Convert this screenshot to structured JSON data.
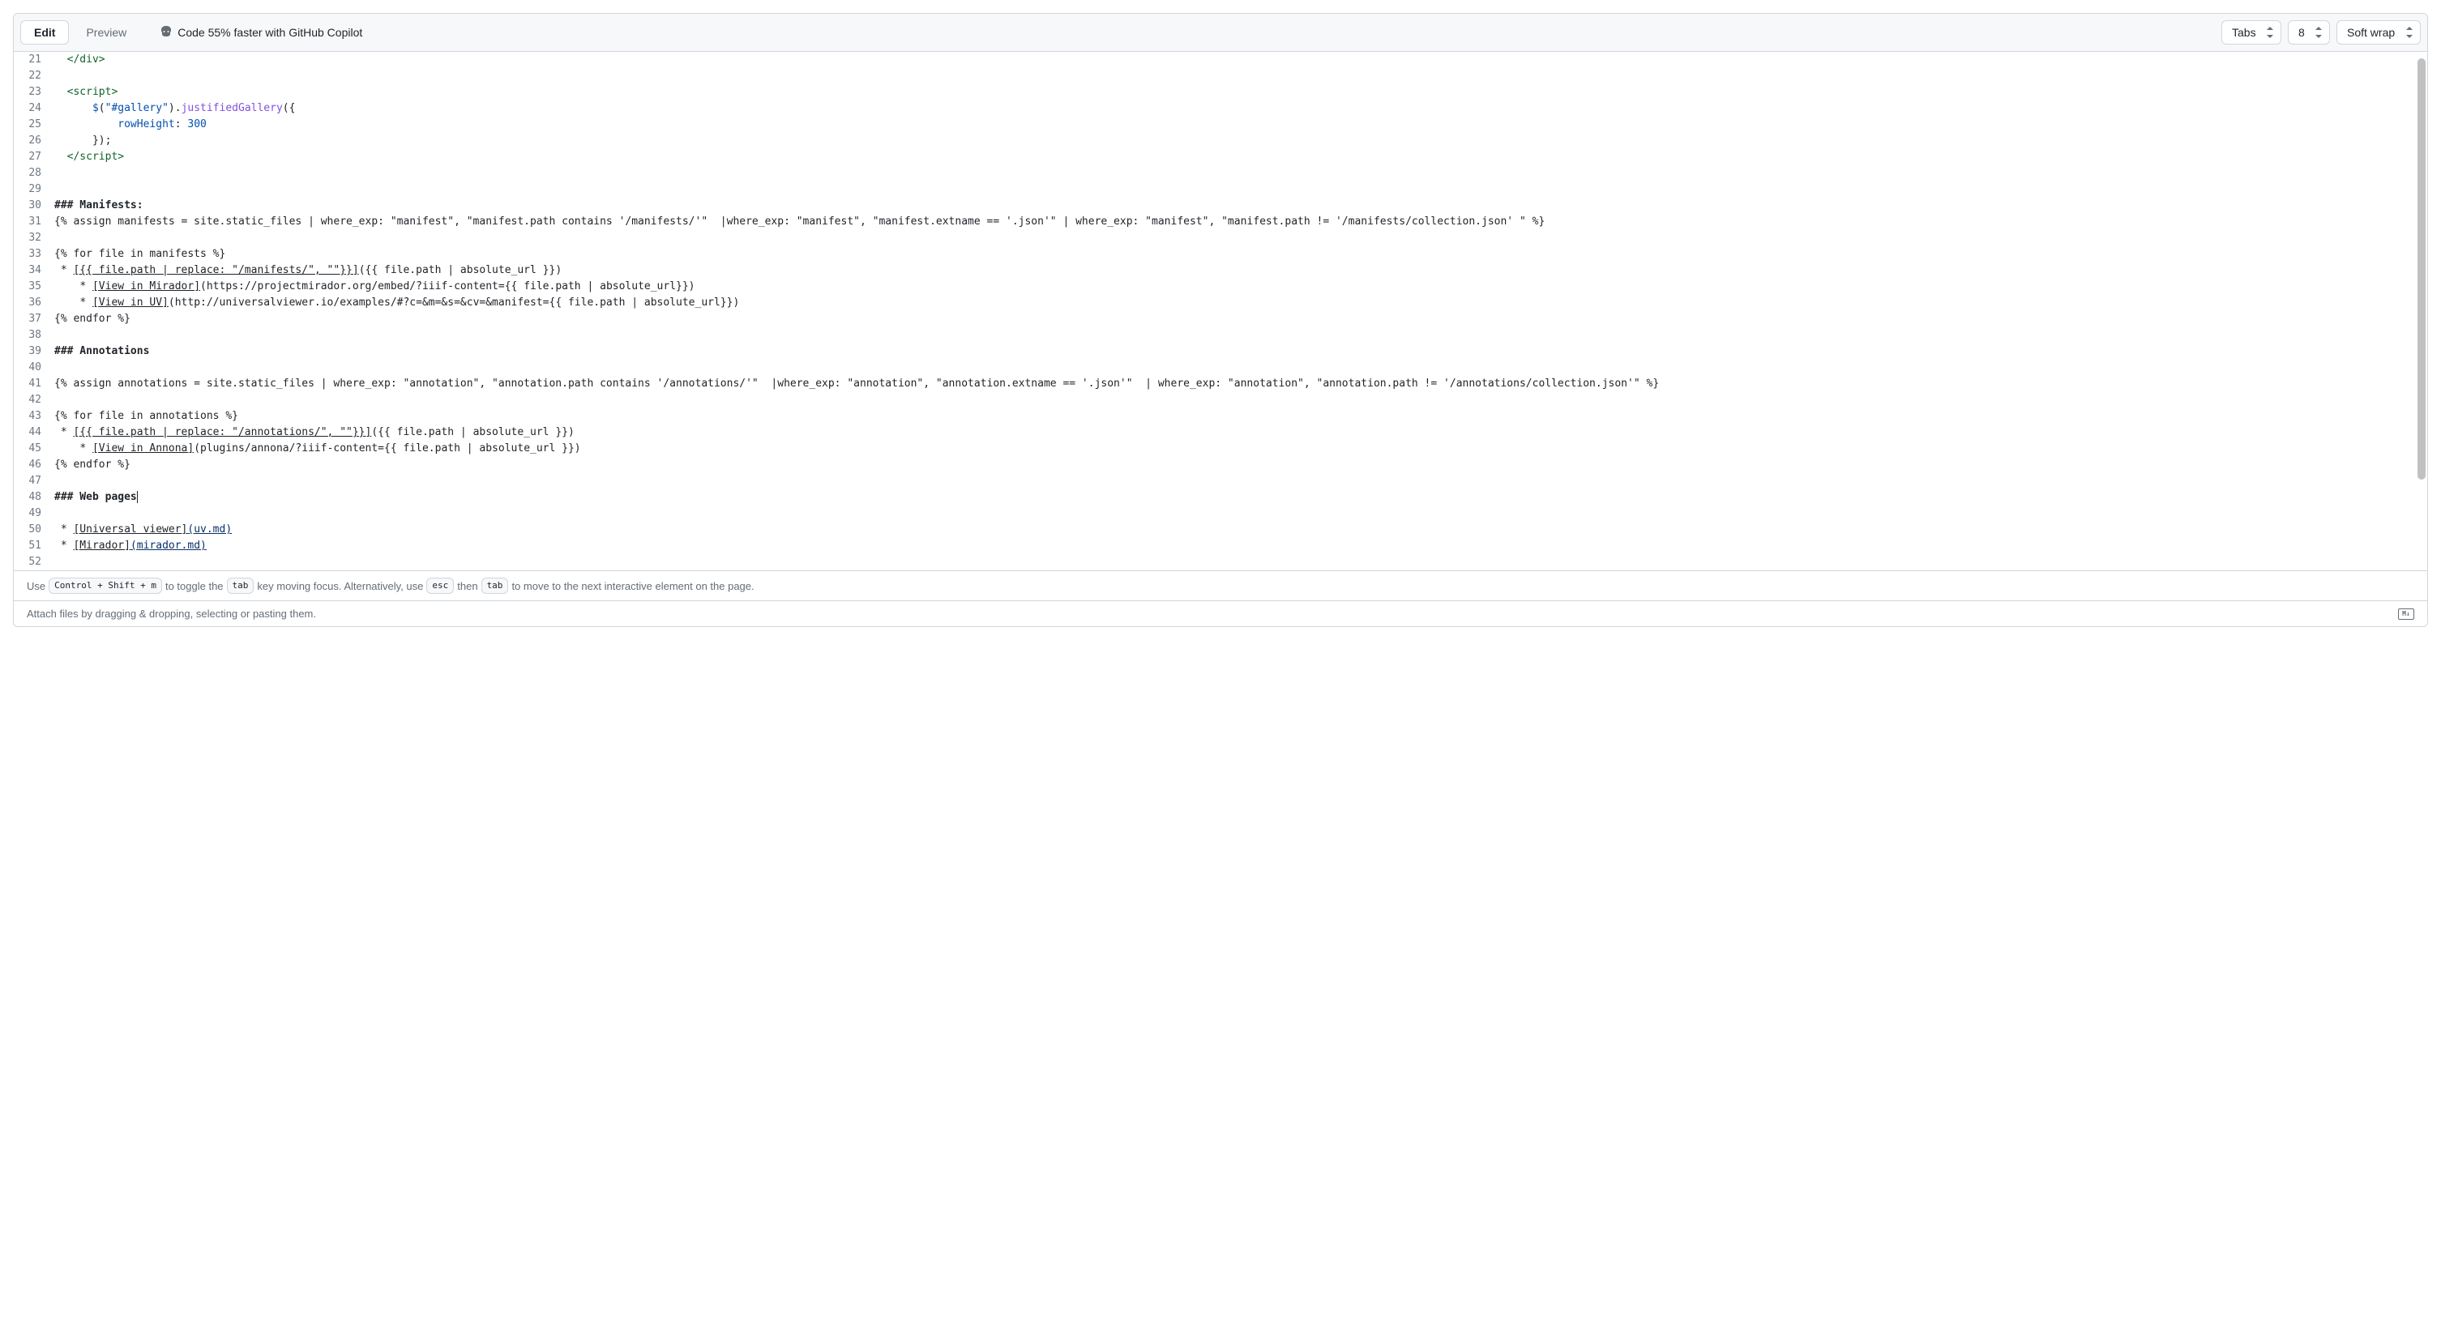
{
  "toolbar": {
    "tabs": {
      "edit": "Edit",
      "preview": "Preview"
    },
    "copilot_hint": "Code 55% faster with GitHub Copilot",
    "selects": {
      "indent": {
        "options": [
          "Tabs"
        ],
        "selected": "Tabs"
      },
      "indent_size": {
        "options": [
          "8"
        ],
        "selected": "8"
      },
      "wrap": {
        "options": [
          "Soft wrap"
        ],
        "selected": "Soft wrap"
      }
    }
  },
  "editor": {
    "first_line_number": 21,
    "lines": [
      {
        "type": "code",
        "segments": [
          {
            "t": "plain",
            "v": "  "
          },
          {
            "t": "tag",
            "v": "</div>"
          }
        ]
      },
      {
        "type": "code",
        "segments": []
      },
      {
        "type": "code",
        "segments": [
          {
            "t": "plain",
            "v": "  "
          },
          {
            "t": "tag",
            "v": "<script>"
          }
        ]
      },
      {
        "type": "code",
        "segments": [
          {
            "t": "plain",
            "v": "      "
          },
          {
            "t": "attr",
            "v": "$"
          },
          {
            "t": "plain",
            "v": "("
          },
          {
            "t": "attr",
            "v": "\"#gallery\""
          },
          {
            "t": "plain",
            "v": ")."
          },
          {
            "t": "func",
            "v": "justifiedGallery"
          },
          {
            "t": "plain",
            "v": "({"
          }
        ]
      },
      {
        "type": "code",
        "segments": [
          {
            "t": "plain",
            "v": "          "
          },
          {
            "t": "attr",
            "v": "rowHeight"
          },
          {
            "t": "plain",
            "v": ": "
          },
          {
            "t": "num",
            "v": "300"
          }
        ]
      },
      {
        "type": "code",
        "segments": [
          {
            "t": "plain",
            "v": "      });"
          }
        ]
      },
      {
        "type": "code",
        "segments": [
          {
            "t": "plain",
            "v": "  "
          },
          {
            "t": "tag",
            "v": "</scr"
          },
          {
            "t": "tag",
            "v": "ipt>"
          }
        ]
      },
      {
        "type": "code",
        "segments": []
      },
      {
        "type": "code",
        "segments": []
      },
      {
        "type": "code",
        "segments": [
          {
            "t": "bold",
            "v": "### Manifests:"
          }
        ]
      },
      {
        "type": "code",
        "segments": [
          {
            "t": "plain",
            "v": "{% assign manifests = site.static_files | where_exp: \"manifest\", \"manifest.path contains '/manifests/'\"  |where_exp: \"manifest\", \"manifest.extname == '.json'\" | where_exp: \"manifest\", \"manifest.path != '/manifests/collection.json' \" %}"
          }
        ]
      },
      {
        "type": "code",
        "segments": []
      },
      {
        "type": "code",
        "segments": [
          {
            "t": "plain",
            "v": "{% for file in manifests %}"
          }
        ]
      },
      {
        "type": "code",
        "segments": [
          {
            "t": "plain",
            "v": " * "
          },
          {
            "t": "link",
            "v": "[{{ file.path | replace: \"/manifests/\", \"\"}}]"
          },
          {
            "t": "plain",
            "v": "({{ file.path | absolute_url }})"
          }
        ]
      },
      {
        "type": "code",
        "segments": [
          {
            "t": "plain",
            "v": "    * "
          },
          {
            "t": "link",
            "v": "[View in Mirador]"
          },
          {
            "t": "plain",
            "v": "(https://projectmirador.org/embed/?iiif-content={{ file.path | absolute_url}})"
          }
        ]
      },
      {
        "type": "code",
        "segments": [
          {
            "t": "plain",
            "v": "    * "
          },
          {
            "t": "link",
            "v": "[View in UV]"
          },
          {
            "t": "plain",
            "v": "(http://universalviewer.io/examples/#?c=&m=&s=&cv=&manifest={{ file.path | absolute_url}})"
          }
        ]
      },
      {
        "type": "code",
        "segments": [
          {
            "t": "plain",
            "v": "{% endfor %}"
          }
        ]
      },
      {
        "type": "code",
        "segments": []
      },
      {
        "type": "code",
        "segments": [
          {
            "t": "bold",
            "v": "### Annotations"
          }
        ]
      },
      {
        "type": "code",
        "segments": []
      },
      {
        "type": "code",
        "segments": [
          {
            "t": "plain",
            "v": "{% assign annotations = site.static_files | where_exp: \"annotation\", \"annotation.path contains '/annotations/'\"  |where_exp: \"annotation\", \"annotation.extname == '.json'\"  | where_exp: \"annotation\", \"annotation.path != '/annotations/collection.json'\" %}"
          }
        ]
      },
      {
        "type": "code",
        "segments": []
      },
      {
        "type": "code",
        "segments": [
          {
            "t": "plain",
            "v": "{% for file in annotations %}"
          }
        ]
      },
      {
        "type": "code",
        "segments": [
          {
            "t": "plain",
            "v": " * "
          },
          {
            "t": "link",
            "v": "[{{ file.path | replace: \"/annotations/\", \"\"}}]"
          },
          {
            "t": "plain",
            "v": "({{ file.path | absolute_url }})"
          }
        ]
      },
      {
        "type": "code",
        "segments": [
          {
            "t": "plain",
            "v": "    * "
          },
          {
            "t": "link",
            "v": "[View in Annona]"
          },
          {
            "t": "plain",
            "v": "(plugins/annona/?iiif-content={{ file.path | absolute_url }})"
          }
        ]
      },
      {
        "type": "code",
        "segments": [
          {
            "t": "plain",
            "v": "{% endfor %}"
          }
        ]
      },
      {
        "type": "code",
        "segments": []
      },
      {
        "type": "code",
        "segments": [
          {
            "t": "bold",
            "v": "### Web pages"
          }
        ],
        "caret": true
      },
      {
        "type": "code",
        "segments": []
      },
      {
        "type": "code",
        "segments": [
          {
            "t": "plain",
            "v": " * "
          },
          {
            "t": "link",
            "v": "[Universal viewer]"
          },
          {
            "t": "url",
            "v": "(uv.md)"
          }
        ]
      },
      {
        "type": "code",
        "segments": [
          {
            "t": "plain",
            "v": " * "
          },
          {
            "t": "link",
            "v": "[Mirador]"
          },
          {
            "t": "url",
            "v": "(mirador.md)"
          }
        ]
      },
      {
        "type": "code",
        "segments": []
      }
    ]
  },
  "footer": {
    "help_parts": {
      "pre1": "Use ",
      "kbd1": "Control + Shift + m",
      "mid1": " to toggle the ",
      "kbd2": "tab",
      "mid2": " key moving focus. Alternatively, use ",
      "kbd3": "esc",
      "mid3": " then ",
      "kbd4": "tab",
      "post": " to move to the next interactive element on the page."
    },
    "attach_hint": "Attach files by dragging & dropping, selecting or pasting them.",
    "markdown_label": "M↓"
  }
}
